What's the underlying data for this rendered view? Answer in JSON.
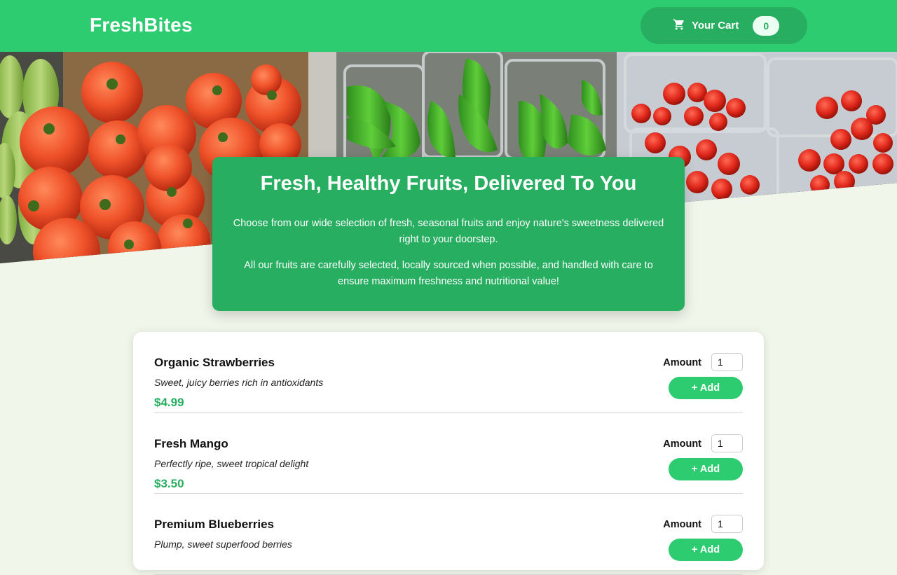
{
  "header": {
    "brand": "FreshBites",
    "cart": {
      "label": "Your Cart",
      "count": "0",
      "icon": "cart-icon"
    }
  },
  "hero": {
    "image": "produce-market-photo",
    "title": "Fresh, Healthy Fruits, Delivered To You",
    "paragraph1": "Choose from our wide selection of fresh, seasonal fruits and enjoy nature's sweetness delivered right to your doorstep.",
    "paragraph2": "All our fruits are carefully selected, locally sourced when possible, and handled with care to ensure maximum freshness and nutritional value!"
  },
  "products": [
    {
      "name": "Organic Strawberries",
      "description": "Sweet, juicy berries rich in antioxidants",
      "price": "$4.99",
      "amount_label": "Amount",
      "amount": "1",
      "add_label": "+ Add"
    },
    {
      "name": "Fresh Mango",
      "description": "Perfectly ripe, sweet tropical delight",
      "price": "$3.50",
      "amount_label": "Amount",
      "amount": "1",
      "add_label": "+ Add"
    },
    {
      "name": "Premium Blueberries",
      "description": "Plump, sweet superfood berries",
      "price": "",
      "amount_label": "Amount",
      "amount": "1",
      "add_label": "+ Add"
    }
  ],
  "colors": {
    "primary": "#2ecc71",
    "primary_dark": "#27ae60",
    "background": "#f1f6ea"
  }
}
